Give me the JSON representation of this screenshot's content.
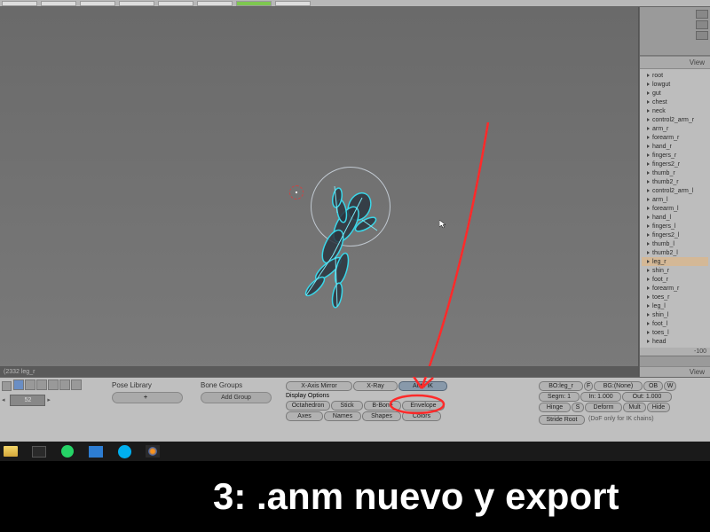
{
  "toolbar": {
    "view_header": "View"
  },
  "viewport": {
    "status_left": "(2332 leg_r"
  },
  "outliner": {
    "items": [
      {
        "name": "root",
        "hl": false
      },
      {
        "name": "lowgut",
        "hl": false
      },
      {
        "name": "gut",
        "hl": false
      },
      {
        "name": "chest",
        "hl": false
      },
      {
        "name": "neck",
        "hl": false
      },
      {
        "name": "control2_arm_r",
        "hl": false
      },
      {
        "name": "arm_r",
        "hl": false
      },
      {
        "name": "forearm_r",
        "hl": false
      },
      {
        "name": "hand_r",
        "hl": false
      },
      {
        "name": "fingers_r",
        "hl": false
      },
      {
        "name": "fingers2_r",
        "hl": false
      },
      {
        "name": "thumb_r",
        "hl": false
      },
      {
        "name": "thumb2_r",
        "hl": false
      },
      {
        "name": "control2_arm_l",
        "hl": false
      },
      {
        "name": "arm_l",
        "hl": false
      },
      {
        "name": "forearm_l",
        "hl": false
      },
      {
        "name": "hand_l",
        "hl": false
      },
      {
        "name": "fingers_l",
        "hl": false
      },
      {
        "name": "fingers2_l",
        "hl": false
      },
      {
        "name": "thumb_l",
        "hl": false
      },
      {
        "name": "thumb2_l",
        "hl": false
      },
      {
        "name": "leg_r",
        "hl": true
      },
      {
        "name": "shin_r",
        "hl": false
      },
      {
        "name": "foot_r",
        "hl": false
      },
      {
        "name": "forearm_r",
        "hl": false
      },
      {
        "name": "toes_r",
        "hl": false
      },
      {
        "name": "leg_l",
        "hl": false
      },
      {
        "name": "shin_l",
        "hl": false
      },
      {
        "name": "foot_l",
        "hl": false
      },
      {
        "name": "toes_l",
        "hl": false
      },
      {
        "name": "head",
        "hl": false
      }
    ],
    "neg100": "-100"
  },
  "frame": {
    "current": "52"
  },
  "panels": {
    "pose_library": "Pose Library",
    "bone_groups": "Bone Groups",
    "add_group": "Add Group",
    "display_options": "Display Options",
    "x_axis_mirror": "X-Axis Mirror",
    "x_ray": "X-Ray",
    "auto_ik": "Auto IK",
    "octahedron": "Octahedron",
    "stick": "Stick",
    "b_bone": "B-Bone",
    "envelope": "Envelope",
    "axes": "Axes",
    "names": "Names",
    "shapes": "Shapes",
    "colors": "Colors",
    "bo_leg": "BO:leg_r",
    "bg_none": "BG:(None)",
    "ob": "OB",
    "w": "W",
    "segm": "Segm: 1",
    "in": "In: 1.000",
    "out": "Out: 1.000",
    "hinge": "Hinge",
    "s": "S",
    "deform": "Deform",
    "mult": "Mult",
    "hide": "Hide",
    "stride_root": "Stride Root",
    "dof_note": "(DoF only for IK chains)"
  },
  "caption": "3: .anm nuevo y export"
}
